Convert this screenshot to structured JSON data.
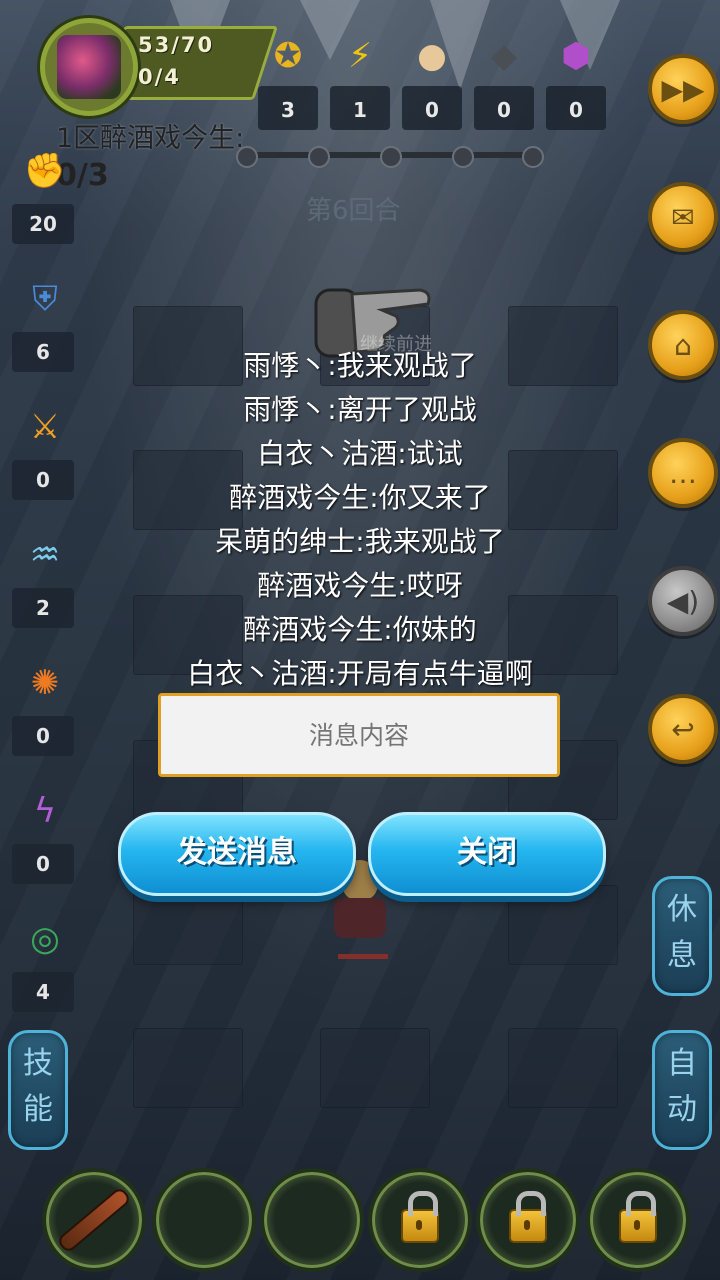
{
  "player": {
    "hp": "53/70",
    "progress": "0/4"
  },
  "currencies": [
    {
      "icon": "gold-coin-icon",
      "glyph": "✪",
      "color": "#e8b420",
      "value": "3"
    },
    {
      "icon": "lightning-icon",
      "glyph": "⚡",
      "color": "#f1c40f",
      "value": "1"
    },
    {
      "icon": "dumpling-icon",
      "glyph": "●",
      "color": "#e6c89a",
      "value": "0"
    },
    {
      "icon": "iron-ingot-icon",
      "glyph": "◆",
      "color": "#4a4f55",
      "value": "0"
    },
    {
      "icon": "crystal-icon",
      "glyph": "⬢",
      "color": "#b04fc9",
      "value": "0"
    }
  ],
  "stage": {
    "title": "1区醉酒戏今生:",
    "count": "0/3",
    "round": "第6回合"
  },
  "left_items": [
    {
      "icon": "fist-icon",
      "glyph": "✊",
      "color": "#c07a3a",
      "value": "20"
    },
    {
      "icon": "shield-icon",
      "glyph": "⛨",
      "color": "#4a8ad6",
      "value": "6"
    },
    {
      "icon": "flame-sword-icon",
      "glyph": "⚔",
      "color": "#f0a020",
      "value": "0"
    },
    {
      "icon": "water-wave-icon",
      "glyph": "♒",
      "color": "#7ecbf0",
      "value": "2"
    },
    {
      "icon": "fire-orb-icon",
      "glyph": "✺",
      "color": "#f07a20",
      "value": "0"
    },
    {
      "icon": "lightning-bolt-icon",
      "glyph": "ϟ",
      "color": "#b45fd6",
      "value": "0"
    },
    {
      "icon": "green-ring-icon",
      "glyph": "◎",
      "color": "#3aa85a",
      "value": "4"
    }
  ],
  "right_buttons": [
    {
      "name": "fast-forward-button",
      "glyph": "▶▶",
      "style": "gold"
    },
    {
      "name": "mail-button",
      "glyph": "✉",
      "style": "gold"
    },
    {
      "name": "home-button",
      "glyph": "⌂",
      "style": "gold"
    },
    {
      "name": "chat-button",
      "glyph": "…",
      "style": "gold"
    },
    {
      "name": "sound-button",
      "glyph": "◀)",
      "style": "grey"
    },
    {
      "name": "return-button",
      "glyph": "↩",
      "style": "gold"
    }
  ],
  "side_tabs": {
    "rest": "休\n息",
    "auto": "自\n动",
    "skill": "技\n能"
  },
  "chat": {
    "hand_label": "继续前进",
    "messages": [
      "雨悸丶:我来观战了",
      "雨悸丶:离开了观战",
      "白衣丶沽酒:试试",
      "醉酒戏今生:你又来了",
      "呆萌的绅士:我来观战了",
      "醉酒戏今生:哎呀",
      "醉酒戏今生:你妹的",
      "白衣丶沽酒:开局有点牛逼啊"
    ],
    "input_placeholder": "消息内容",
    "send_label": "发送消息",
    "close_label": "关闭"
  },
  "skill_slots": [
    "weapon",
    "empty",
    "empty",
    "locked",
    "locked",
    "locked"
  ]
}
